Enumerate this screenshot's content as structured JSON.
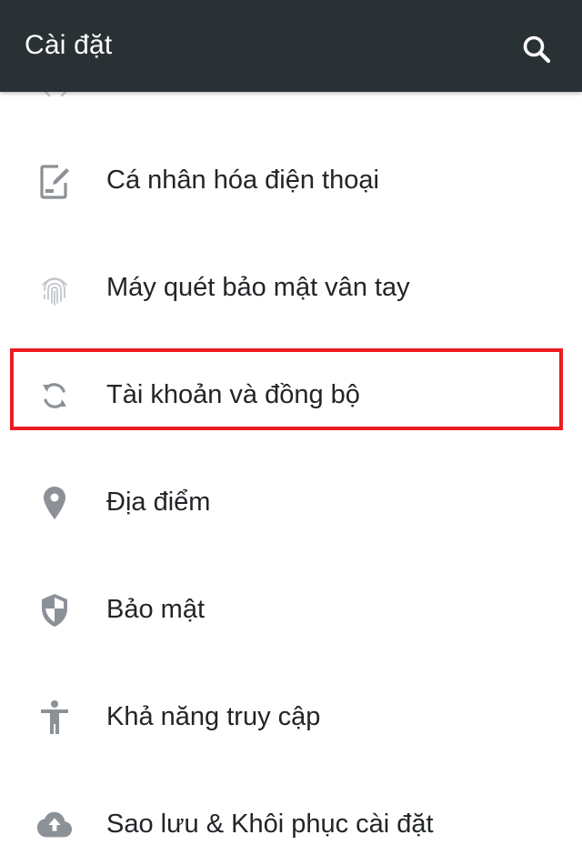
{
  "app_bar": {
    "title": "Cài đặt",
    "background": "#2a3135"
  },
  "icons": {
    "search": "search-icon",
    "personalize": "phone-edit-icon",
    "fingerprint": "fingerprint-icon",
    "sync": "sync-icon",
    "location": "location-pin-icon",
    "security": "shield-icon",
    "accessibility": "accessibility-icon",
    "backup": "cloud-upload-icon"
  },
  "settings": {
    "items": [
      {
        "label": "Cá nhân hóa điện thoại"
      },
      {
        "label": "Máy quét bảo mật vân tay"
      },
      {
        "label": "Tài khoản và đồng bộ"
      },
      {
        "label": "Địa điểm"
      },
      {
        "label": "Bảo mật"
      },
      {
        "label": "Khả năng truy cập"
      },
      {
        "label": "Sao lưu & Khôi phục cài đặt"
      }
    ]
  },
  "colors": {
    "icon": "#8c9197",
    "text": "#222528",
    "highlight": "#ec1c24"
  }
}
